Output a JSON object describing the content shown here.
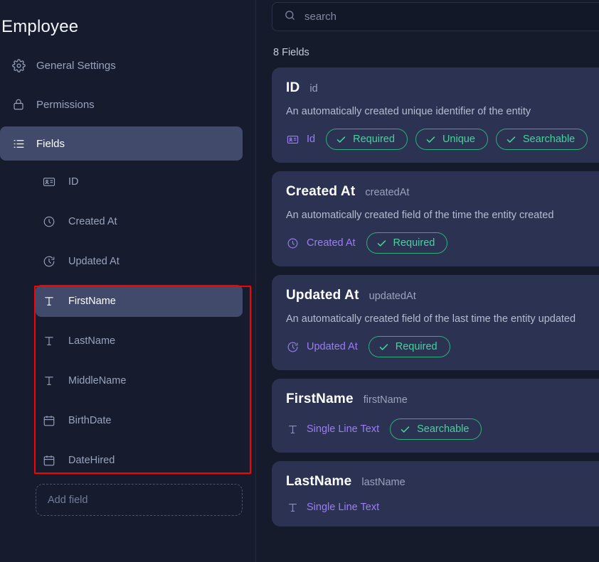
{
  "sidebar": {
    "title": "Employee",
    "nav": [
      {
        "label": "General Settings",
        "icon": "gear-icon",
        "active": false
      },
      {
        "label": "Permissions",
        "icon": "lock-icon",
        "active": false
      },
      {
        "label": "Fields",
        "icon": "list-icon",
        "active": true
      }
    ],
    "fields": [
      {
        "label": "ID",
        "icon": "id-card-icon",
        "active": false
      },
      {
        "label": "Created At",
        "icon": "clock-icon",
        "active": false
      },
      {
        "label": "Updated At",
        "icon": "clock-history-icon",
        "active": false
      },
      {
        "label": "FirstName",
        "icon": "text-icon",
        "active": true
      },
      {
        "label": "LastName",
        "icon": "text-icon",
        "active": false
      },
      {
        "label": "MiddleName",
        "icon": "text-icon",
        "active": false
      },
      {
        "label": "BirthDate",
        "icon": "calendar-icon",
        "active": false
      },
      {
        "label": "DateHired",
        "icon": "calendar-icon",
        "active": false
      }
    ],
    "add_field_label": "Add field"
  },
  "main": {
    "search": {
      "placeholder": "search",
      "value": "",
      "icon": "search-icon"
    },
    "fields_count_label": "8 Fields",
    "cards": [
      {
        "name": "ID",
        "key": "id",
        "description": "An automatically created unique identifier of the entity",
        "type_icon": "id-card-icon",
        "type_label": "Id",
        "badges": [
          "Required",
          "Unique",
          "Searchable"
        ]
      },
      {
        "name": "Created At",
        "key": "createdAt",
        "description": "An automatically created field of the time the entity created",
        "type_icon": "clock-icon",
        "type_label": "Created At",
        "badges": [
          "Required"
        ]
      },
      {
        "name": "Updated At",
        "key": "updatedAt",
        "description": "An automatically created field of the last time the entity updated",
        "type_icon": "clock-history-icon",
        "type_label": "Updated At",
        "badges": [
          "Required"
        ]
      },
      {
        "name": "FirstName",
        "key": "firstName",
        "description": "",
        "type_icon": "text-icon",
        "type_label": "Single Line Text",
        "badges": [
          "Searchable"
        ]
      },
      {
        "name": "LastName",
        "key": "lastName",
        "description": "",
        "type_icon": "text-icon",
        "type_label": "Single Line Text",
        "badges": []
      }
    ]
  },
  "annotation": {
    "shape": "rectangle",
    "color": "#ff0000"
  },
  "colors": {
    "background": "#151b2b",
    "sidebar": "#161c2e",
    "card": "#2b3252",
    "active": "#414a6b",
    "accent_purple": "#9c7df5",
    "accent_green": "#46d39c",
    "badge_border": "#2fae7f",
    "annotation": "#ff0000"
  }
}
